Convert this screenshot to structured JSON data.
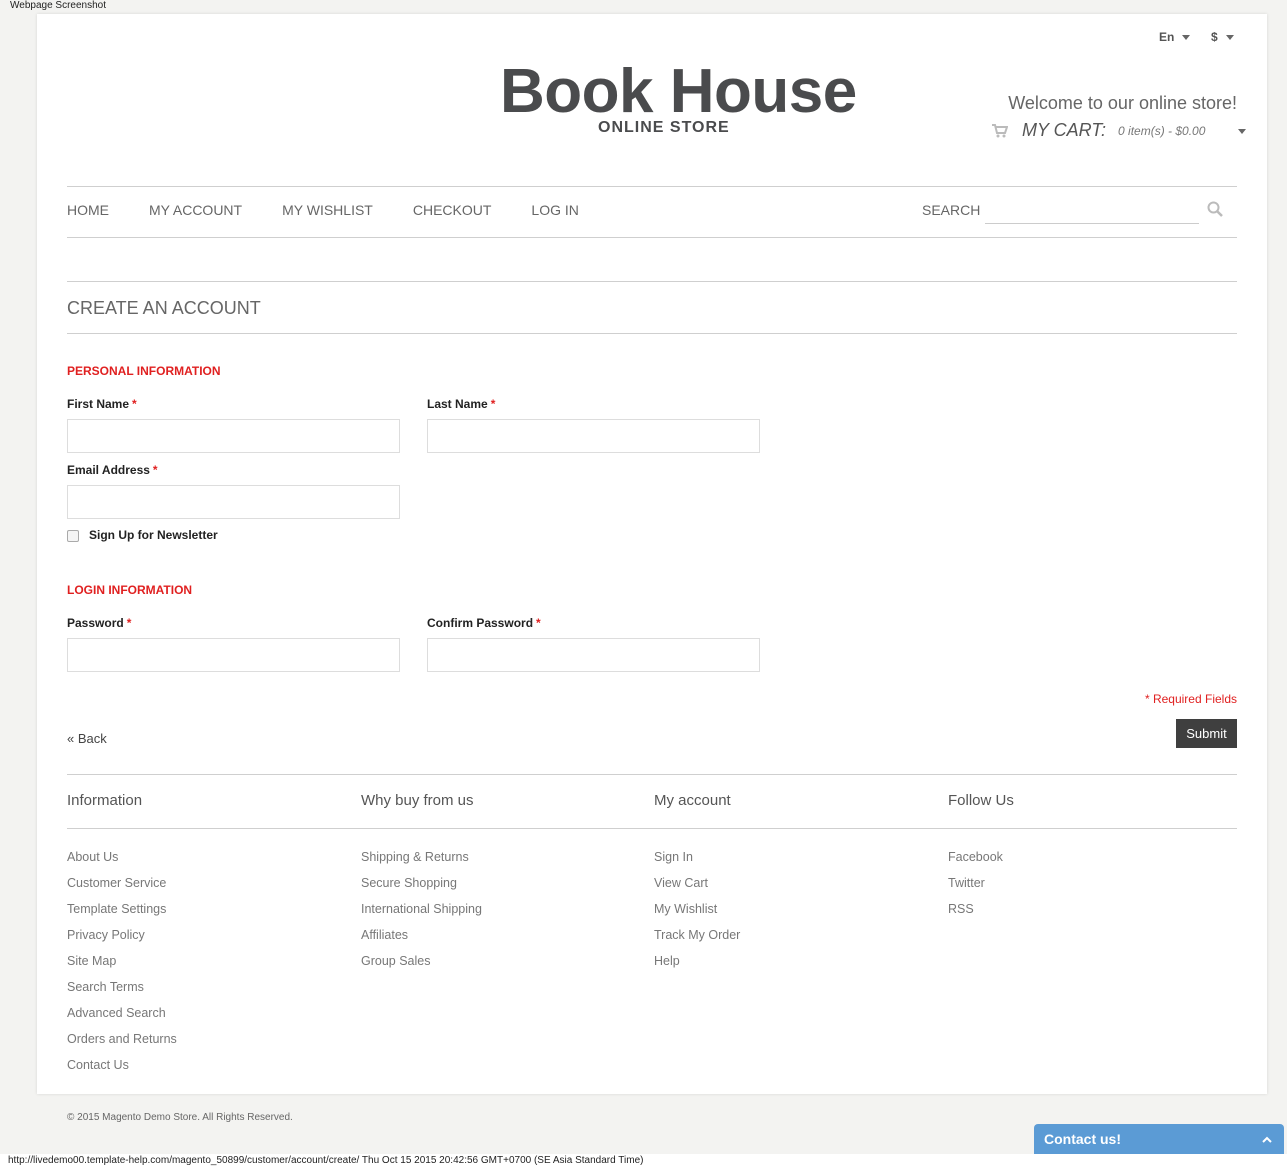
{
  "screenshot_label": "Webpage Screenshot",
  "header": {
    "language": "En",
    "currency": "$",
    "logo_title": "Book House",
    "logo_subtitle": "ONLINE STORE",
    "welcome": "Welcome to our online store!",
    "cart_label": "MY CART:",
    "cart_summary": "0 item(s) - $0.00"
  },
  "nav": {
    "items": [
      {
        "label": "HOME"
      },
      {
        "label": "MY ACCOUNT"
      },
      {
        "label": "MY WISHLIST"
      },
      {
        "label": "CHECKOUT"
      },
      {
        "label": "LOG IN"
      }
    ],
    "search_label": "SEARCH",
    "search_value": ""
  },
  "form": {
    "title": "CREATE AN ACCOUNT",
    "personal_heading": "PERSONAL INFORMATION",
    "first_name_label": "First Name",
    "last_name_label": "Last Name",
    "email_label": "Email Address",
    "newsletter_label": "Sign Up for Newsletter",
    "login_heading": "LOGIN INFORMATION",
    "password_label": "Password",
    "confirm_password_label": "Confirm Password",
    "required_marker": "*",
    "required_note": "* Required Fields",
    "back_label": "« Back",
    "submit_label": "Submit"
  },
  "footer": {
    "columns": [
      {
        "title": "Information",
        "links": [
          "About Us",
          "Customer Service",
          "Template Settings",
          "Privacy Policy",
          "Site Map",
          "Search Terms",
          "Advanced Search",
          "Orders and Returns",
          "Contact Us"
        ]
      },
      {
        "title": "Why buy from us",
        "links": [
          "Shipping & Returns",
          "Secure Shopping",
          "International Shipping",
          "Affiliates",
          "Group Sales"
        ]
      },
      {
        "title": "My account",
        "links": [
          "Sign In",
          "View Cart",
          "My Wishlist",
          "Track My Order",
          "Help"
        ]
      },
      {
        "title": "Follow Us",
        "links": [
          "Facebook",
          "Twitter",
          "RSS"
        ]
      }
    ],
    "copyright": "© 2015 Magento Demo Store. All Rights Reserved."
  },
  "contact_widget": {
    "label": "Contact us!"
  },
  "status_bar": "http://livedemo00.template-help.com/magento_50899/customer/account/create/ Thu Oct 15 2015 20:42:56 GMT+0700 (SE Asia Standard Time)"
}
